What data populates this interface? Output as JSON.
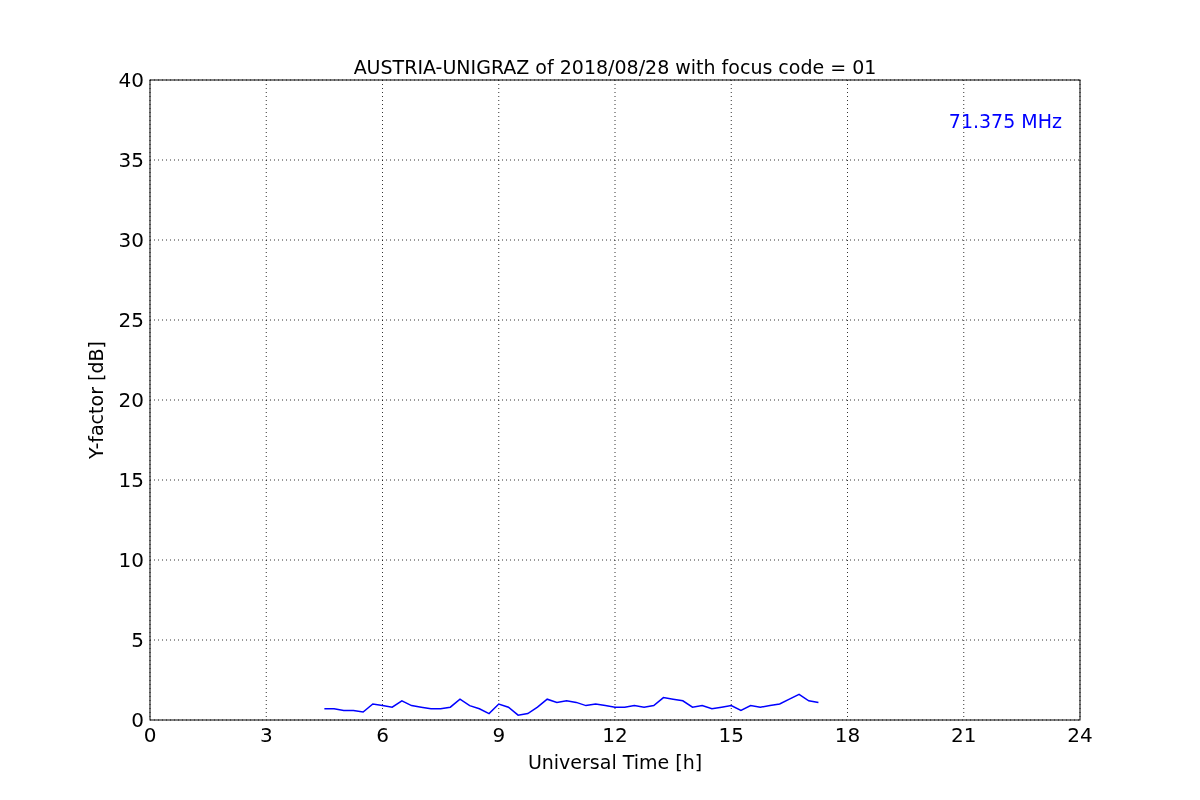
{
  "chart_data": {
    "type": "line",
    "title": "AUSTRIA-UNIGRAZ of 2018/08/28 with focus code = 01",
    "xlabel": "Universal Time [h]",
    "ylabel": "Y-factor [dB]",
    "x": [
      4.5,
      4.75,
      5,
      5.25,
      5.5,
      5.75,
      6,
      6.25,
      6.5,
      6.75,
      7,
      7.25,
      7.5,
      7.75,
      8,
      8.25,
      8.5,
      8.75,
      9,
      9.25,
      9.5,
      9.75,
      10,
      10.25,
      10.5,
      10.75,
      11,
      11.25,
      11.5,
      11.75,
      12,
      12.25,
      12.5,
      12.75,
      13,
      13.25,
      13.5,
      13.75,
      14,
      14.25,
      14.5,
      14.75,
      15,
      15.25,
      15.5,
      15.75,
      16,
      16.25,
      16.5,
      16.75,
      17,
      17.25
    ],
    "series": [
      {
        "name": "71.375 MHz",
        "color": "#0000ff",
        "values": [
          0.7,
          0.7,
          0.6,
          0.6,
          0.5,
          1.0,
          0.9,
          0.8,
          1.2,
          0.9,
          0.8,
          0.7,
          0.7,
          0.8,
          1.3,
          0.9,
          0.7,
          0.4,
          1.0,
          0.8,
          0.3,
          0.4,
          0.8,
          1.3,
          1.1,
          1.2,
          1.1,
          0.9,
          1.0,
          0.9,
          0.8,
          0.8,
          0.9,
          0.8,
          0.9,
          1.4,
          1.3,
          1.2,
          0.8,
          0.9,
          0.7,
          0.8,
          0.9,
          0.6,
          0.9,
          0.8,
          0.9,
          1.0,
          1.3,
          1.6,
          1.2,
          1.1
        ]
      }
    ],
    "xlim": [
      0,
      24
    ],
    "ylim": [
      0,
      40
    ],
    "xticks": [
      0,
      3,
      6,
      9,
      12,
      15,
      18,
      21,
      24
    ],
    "yticks": [
      0,
      5,
      10,
      15,
      20,
      25,
      30,
      35,
      40
    ],
    "grid": true
  }
}
